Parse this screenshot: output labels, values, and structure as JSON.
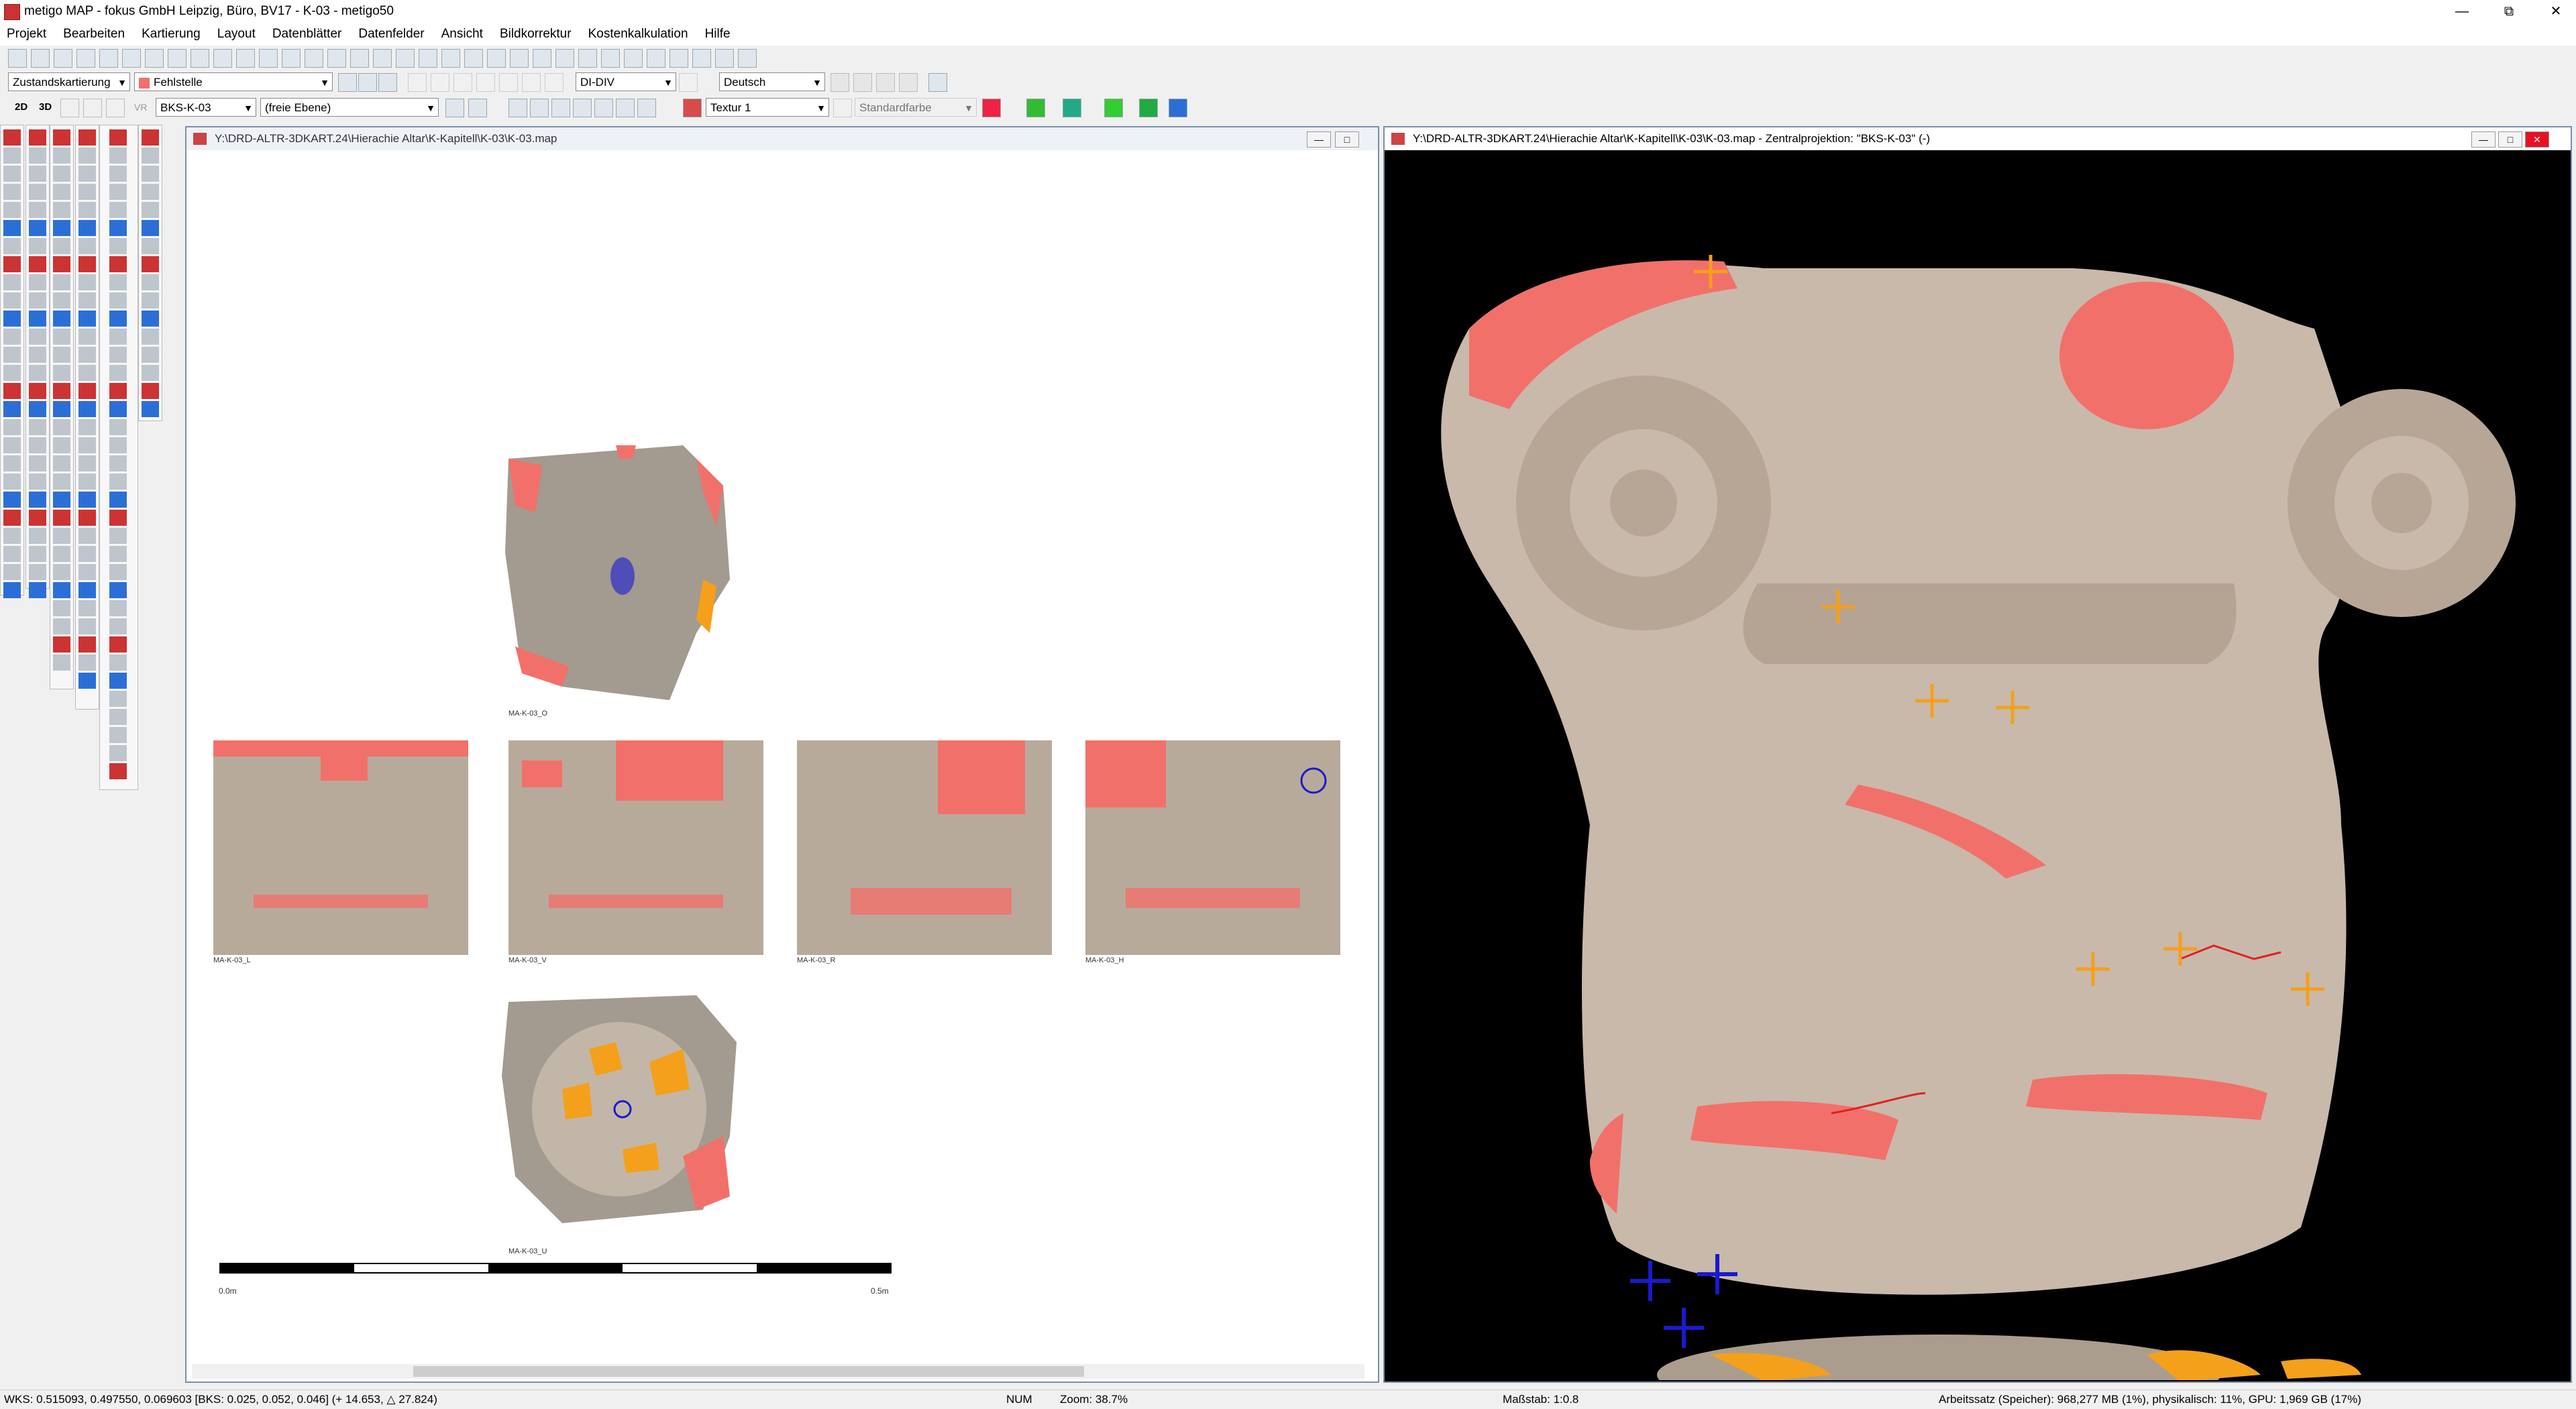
{
  "window": {
    "title": "metigo MAP - fokus GmbH Leipzig, Büro, BV17 - K-03 - metigo50"
  },
  "menu": [
    "Projekt",
    "Bearbeiten",
    "Kartierung",
    "Layout",
    "Datenblätter",
    "Datenfelder",
    "Ansicht",
    "Bildkorrektur",
    "Kostenkalkulation",
    "Hilfe"
  ],
  "toolbar2": {
    "mapping_type": "Zustandskartierung",
    "category": "Fehlstelle",
    "format": "DI-DIV",
    "language": "Deutsch"
  },
  "toolbar3": {
    "view2d": "2D",
    "view3d": "3D",
    "vr": "VR",
    "object": "BKS-K-03",
    "layer": "(freie Ebene)",
    "texture": "Textur 1",
    "color": "Standardfarbe"
  },
  "left_window": {
    "title": "Y:\\DRD-ALTR-3DKART.24\\Hierachie Altar\\K-Kapitell\\K-03\\K-03.map",
    "captions": [
      "MA-K-03_O",
      "MA-K-03_L",
      "MA-K-03_V",
      "MA-K-03_R",
      "MA-K-03_H",
      "MA-K-03_U"
    ],
    "scale_start": "0.0m",
    "scale_end": "0.5m"
  },
  "right_window": {
    "title": "Y:\\DRD-ALTR-3DKART.24\\Hierachie Altar\\K-Kapitell\\K-03\\K-03.map - Zentralprojektion: \"BKS-K-03\" (-)"
  },
  "statusbar": {
    "coords": "WKS: 0.515093, 0.497550, 0.069603 [BKS: 0.025, 0.052, 0.046] (+ 14.653, △ 27.824)",
    "num": "NUM",
    "zoom": "Zoom: 38.7%",
    "scale": "Maßstab: 1:0.8",
    "memory": "Arbeitssatz (Speicher): 968,277 MB (1%), physikalisch: 11%, GPU: 1,969 GB (17%)"
  },
  "colors": {
    "damage_red": "#f2706a",
    "damage_orange": "#f5a01a",
    "stone": "#c9b9aa",
    "marker_blue": "#1a1acc"
  }
}
